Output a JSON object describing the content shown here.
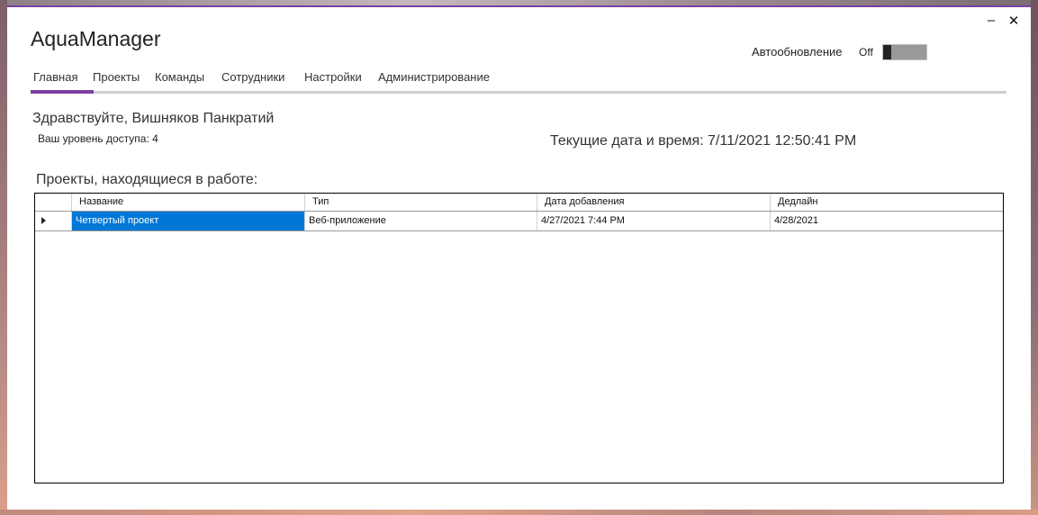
{
  "app": {
    "title": "AquaManager"
  },
  "window_controls": {
    "minimize": "–",
    "close": "✕"
  },
  "autoupdate": {
    "label": "Автообновление",
    "state": "Off"
  },
  "tabs": [
    {
      "label": "Главная",
      "active": true
    },
    {
      "label": "Проекты"
    },
    {
      "label": "Команды"
    },
    {
      "label": "Сотрудники"
    },
    {
      "label": "Настройки"
    },
    {
      "label": "Администрирование"
    }
  ],
  "home": {
    "greeting": "Здравствуйте, Вишняков Панкратий",
    "access_level": "Ваш уровень доступа: 4",
    "current_datetime": "Текущие дата и время: 7/11/2021 12:50:41 PM",
    "section_title": "Проекты, находящиеся в работе:"
  },
  "grid": {
    "columns": [
      "Название",
      "Тип",
      "Дата добавления",
      "Дедлайн"
    ],
    "rows": [
      [
        "Четвертый проект",
        "Веб-приложение",
        "4/27/2021 7:44 PM",
        "4/28/2021"
      ]
    ],
    "selected_color": "#0078d7"
  },
  "colors": {
    "accent": "#7b3fa3"
  }
}
